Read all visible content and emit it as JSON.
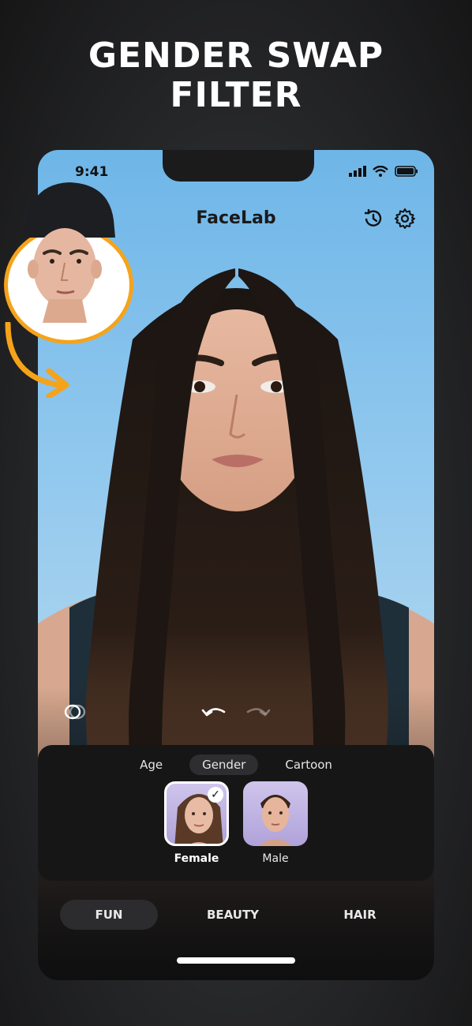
{
  "headline": {
    "line1": "GENDER SWAP",
    "line2": "FILTER"
  },
  "status_bar": {
    "time": "9:41"
  },
  "app": {
    "title": "FaceLab"
  },
  "header_icons": {
    "history": "history-icon",
    "settings": "gear-icon"
  },
  "edit_controls": {
    "compare": "compare-icon",
    "undo": "undo-icon",
    "redo": "redo-icon"
  },
  "filter_tabs": [
    {
      "label": "Age",
      "active": false
    },
    {
      "label": "Gender",
      "active": true
    },
    {
      "label": "Cartoon",
      "active": false
    }
  ],
  "gender_options": [
    {
      "label": "Female",
      "selected": true
    },
    {
      "label": "Male",
      "selected": false
    }
  ],
  "categories": [
    {
      "label": "FUN",
      "active": true
    },
    {
      "label": "BEAUTY",
      "active": false
    },
    {
      "label": "HAIR",
      "active": false
    }
  ],
  "colors": {
    "accent": "#f5a31a",
    "panel": "#161617",
    "sky": "#8cc4ec"
  }
}
